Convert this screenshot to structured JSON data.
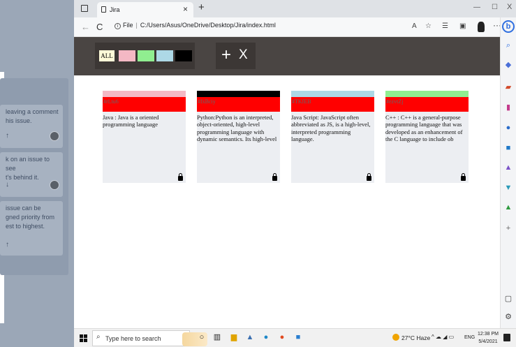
{
  "background_window": {
    "column_count": "3",
    "cards": [
      {
        "text_lines": [
          "leaving a comment",
          "his issue."
        ],
        "arrow": "↑"
      },
      {
        "text_lines": [
          "k on an issue to see",
          "t's behind it."
        ],
        "arrow": "↓"
      },
      {
        "text_lines": [
          "issue can be",
          "gned priority from",
          "est to highest."
        ],
        "arrow": "↑"
      }
    ]
  },
  "browser": {
    "tab_title": "Jira",
    "tab_close": "×",
    "new_tab": "+",
    "url_scheme": "File",
    "url_separator": "|",
    "url": "C:/Users/Asus/OneDrive/Desktop/Jira/index.html",
    "back": "←",
    "refresh": "C",
    "more": "···",
    "minimize": "—",
    "maximize": "☐",
    "close": "X",
    "bing": "b"
  },
  "toolbar": {
    "filter_all_label": "ALL",
    "filter_colors": [
      "#f4b8c4",
      "#90ee90",
      "#add8e6",
      "#000000"
    ],
    "add_label": "+",
    "remove_label": "X"
  },
  "tickets": [
    {
      "id": "#rLtu6",
      "color": "#f4b8c4",
      "desc": "Java : Java is a oriented programming language"
    },
    {
      "id": "#fxBciy",
      "color": "#000000",
      "desc": "Python:Python is an interpreted, object-oriented, high-level programming language with dynamic semantics. Its high-level"
    },
    {
      "id": "#TKfEB",
      "color": "#add8e6",
      "desc": "Java Script: JavaScript often abbreviated as JS, is a high-level, interpreted programming language."
    },
    {
      "id": "#ezvtZj",
      "color": "#90ee90",
      "desc": "C++ : C++ is a general-purpose programming language that was developed as an enhancement of the C language to include ob"
    }
  ],
  "taskbar": {
    "search_placeholder": "Type here to search",
    "weather": "27°C  Haze",
    "tray_icons": "^ ☁ ◢ ▭",
    "language": "ENG",
    "time": "12:38 PM",
    "date": "5/4/2021"
  }
}
